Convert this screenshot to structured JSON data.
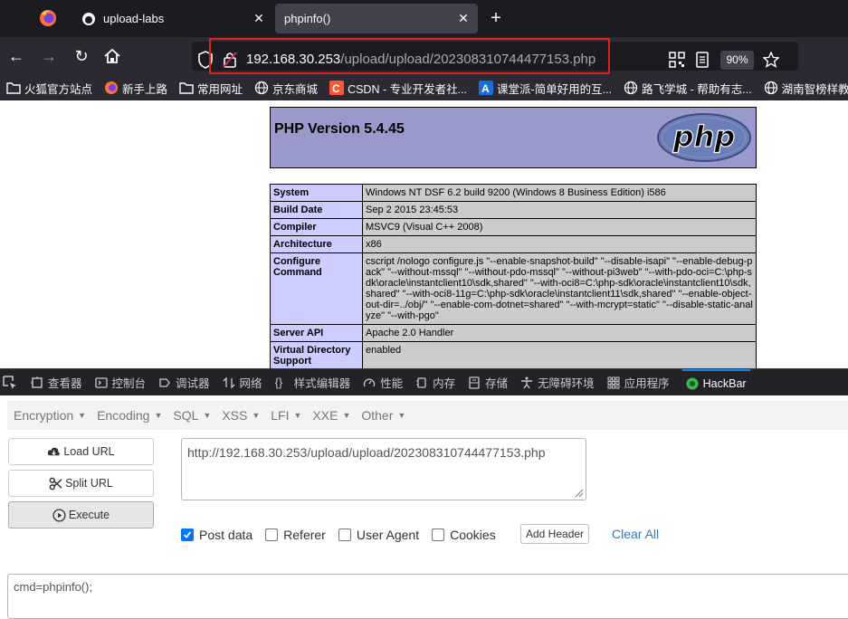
{
  "browser": {
    "tabs": [
      {
        "title": "upload-labs"
      },
      {
        "title": "phpinfo()"
      }
    ],
    "url_host": "192.168.30.253",
    "url_path": "/upload/upload/202308310744477153.php",
    "zoom": "90%",
    "bookmarks": [
      "火狐官方站点",
      "新手上路",
      "常用网址",
      "京东商城",
      "CSDN - 专业开发者社...",
      "课堂派-简单好用的互...",
      "路飞学城 - 帮助有志...",
      "湖南智榜样教育科"
    ]
  },
  "php": {
    "version_title": "PHP Version 5.4.45",
    "logo_text": "php",
    "rows": [
      {
        "key": "System",
        "value": "Windows NT DSF 6.2 build 9200 (Windows 8 Business Edition) i586"
      },
      {
        "key": "Build Date",
        "value": "Sep 2 2015 23:45:53"
      },
      {
        "key": "Compiler",
        "value": "MSVC9 (Visual C++ 2008)"
      },
      {
        "key": "Architecture",
        "value": "x86"
      },
      {
        "key": "Configure Command",
        "value": "cscript /nologo configure.js \"--enable-snapshot-build\" \"--disable-isapi\" \"--enable-debug-pack\" \"--without-mssql\" \"--without-pdo-mssql\" \"--without-pi3web\" \"--with-pdo-oci=C:\\php-sdk\\oracle\\instantclient10\\sdk,shared\" \"--with-oci8=C:\\php-sdk\\oracle\\instantclient10\\sdk,shared\" \"--with-oci8-11g=C:\\php-sdk\\oracle\\instantclient11\\sdk,shared\" \"--enable-object-out-dir=../obj/\" \"--enable-com-dotnet=shared\" \"--with-mcrypt=static\" \"--disable-static-analyze\" \"--with-pgo\""
      },
      {
        "key": "Server API",
        "value": "Apache 2.0 Handler"
      },
      {
        "key": "Virtual Directory Support",
        "value": "enabled"
      }
    ]
  },
  "devtools": {
    "tabs": [
      "查看器",
      "控制台",
      "调试器",
      "网络",
      "样式编辑器",
      "性能",
      "内存",
      "存储",
      "无障碍环境",
      "应用程序",
      "HackBar"
    ]
  },
  "hackbar": {
    "menu": [
      "Encryption",
      "Encoding",
      "SQL",
      "XSS",
      "LFI",
      "XXE",
      "Other"
    ],
    "load_url": "Load URL",
    "split_url": "Split URL",
    "execute": "Execute",
    "url_value": "http://192.168.30.253/upload/upload/202308310744477153.php",
    "options": [
      {
        "label": "Post data",
        "checked": true
      },
      {
        "label": "Referer",
        "checked": false
      },
      {
        "label": "User Agent",
        "checked": false
      },
      {
        "label": "Cookies",
        "checked": false
      }
    ],
    "add_header": "Add Header",
    "clear_all": "Clear All",
    "post_value": "cmd=phpinfo();"
  },
  "colors": {
    "url_highlight": "#e0201f",
    "php_header_bg": "#9999cc",
    "php_key_bg": "#ccccff",
    "php_value_bg": "#cccccc",
    "hackbar_link": "#337ab7",
    "checkbox_on": "#0075ff"
  }
}
